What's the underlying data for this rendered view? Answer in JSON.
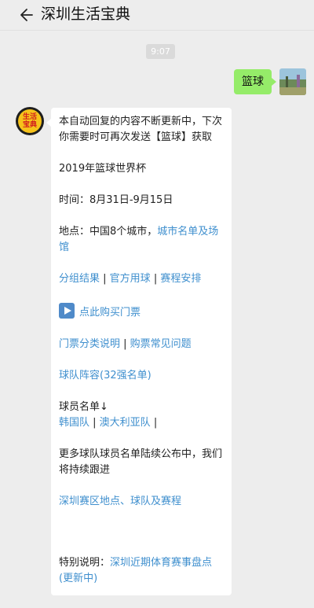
{
  "header": {
    "title": "深圳生活宝典"
  },
  "time": "9:07",
  "user_message": "篮球",
  "avatar_text": [
    "生活",
    "宝典"
  ],
  "reply": {
    "intro": "本自动回复的内容不断更新中，下次你需要时可再次发送【篮球】获取",
    "event": "2019年篮球世界杯",
    "time_line": "时间：8月31日-9月15日",
    "place_label": "地点：中国8个城市，",
    "place_link": "城市名单及场馆",
    "links1": [
      "分组结果",
      "官方用球",
      "赛程安排"
    ],
    "buy_link": "点此购买门票",
    "links2": [
      "门票分类说明",
      "购票常见问题"
    ],
    "team_lineup": "球队阵容(32强名单)",
    "roster_label": "球员名单↓",
    "roster_links": [
      "韩国队",
      "澳大利亚队"
    ],
    "more_text": "更多球队球员名单陆续公布中，我们将持续跟进",
    "shenzhen_link": "深圳赛区地点、球队及赛程",
    "special_label": "特别说明：",
    "special_link": "深圳近期体育赛事盘点(更新中)"
  }
}
